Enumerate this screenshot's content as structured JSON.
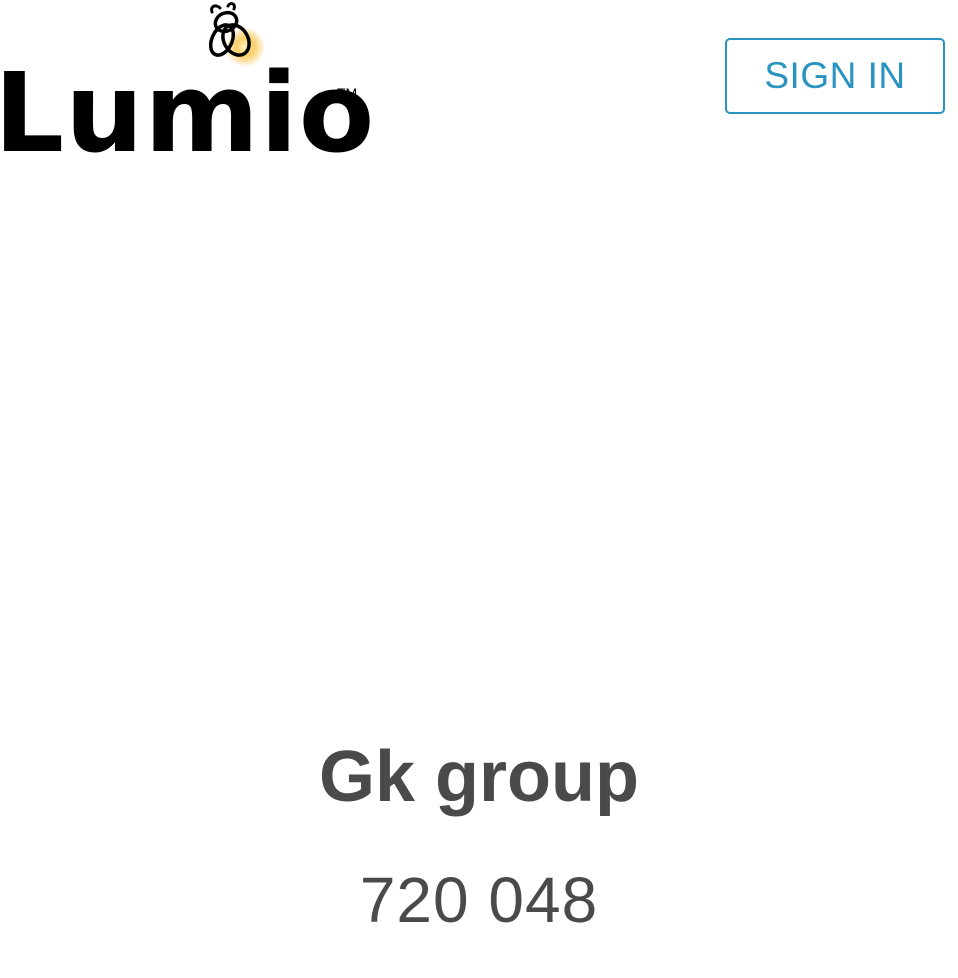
{
  "brand": {
    "name": "Lumio",
    "trademark": "TM",
    "logo_icon": "firefly-icon",
    "text_color": "#000000",
    "glow_color": "#f5b82e"
  },
  "header": {
    "sign_in_label": "SIGN IN",
    "accent_color": "#2a93c0"
  },
  "session": {
    "group_name": "Gk group",
    "join_code": "720 048",
    "text_color": "#4a4a4a"
  }
}
